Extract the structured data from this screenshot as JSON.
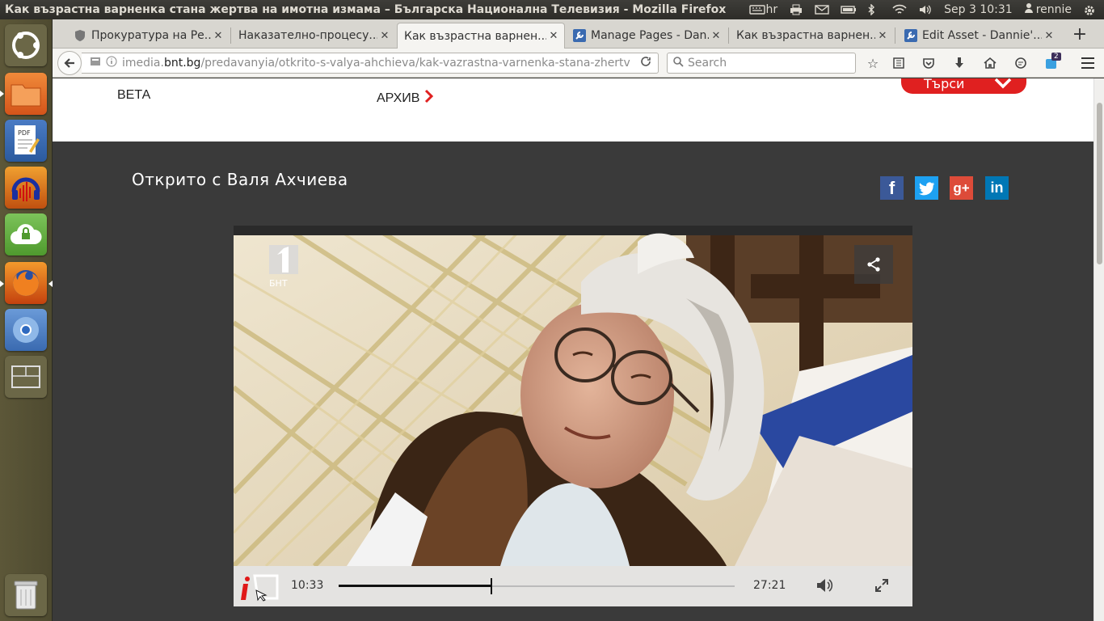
{
  "top_panel": {
    "window_title": "Как възрастна варненка стана жертва на имотна измама – Българска Национална Телевизия - Mozilla Firefox",
    "keyboard_layout": "hr",
    "datetime": "Sep  3 10:31",
    "user": "rennie"
  },
  "launcher": {
    "items": [
      "ubuntu-dash",
      "files",
      "pdf-editor",
      "audacity",
      "cloud-storage",
      "firefox",
      "chromium",
      "workspaces",
      "trash"
    ]
  },
  "tabs": [
    {
      "label": "Прокуратура на Ре...",
      "active": false
    },
    {
      "label": "Наказателно-процесу...",
      "active": false
    },
    {
      "label": "Как възрастна варнен...",
      "active": true
    },
    {
      "label": "Manage Pages - Dan...",
      "active": false
    },
    {
      "label": "Как възрастна варнен...",
      "active": false
    },
    {
      "label": "Edit Asset - Dannie'...",
      "active": false
    }
  ],
  "navbar": {
    "url_prefix": "imedia.",
    "url_domain": "bnt.bg",
    "url_path": "/predavanyia/otkrito-s-valya-ahchieva/kak-vazrastna-varnenka-stana-zhertv",
    "search_placeholder": "Search",
    "notification_badge": "2"
  },
  "page": {
    "nav_veta": "ВЕТА",
    "nav_arhiv": "АРХИВ",
    "search_button": "Търси",
    "show_title": "Открито с Валя Ахчиева",
    "social": [
      "f",
      "t",
      "g+",
      "in"
    ]
  },
  "video": {
    "channel_logo": "БНТ",
    "elapsed": "10:33",
    "duration": "27:21",
    "progress": 0.386
  },
  "colors": {
    "accent_red": "#e02020",
    "facebook": "#3b5998",
    "twitter": "#1da1f2",
    "googleplus": "#dd4b39",
    "linkedin": "#0077b5"
  }
}
